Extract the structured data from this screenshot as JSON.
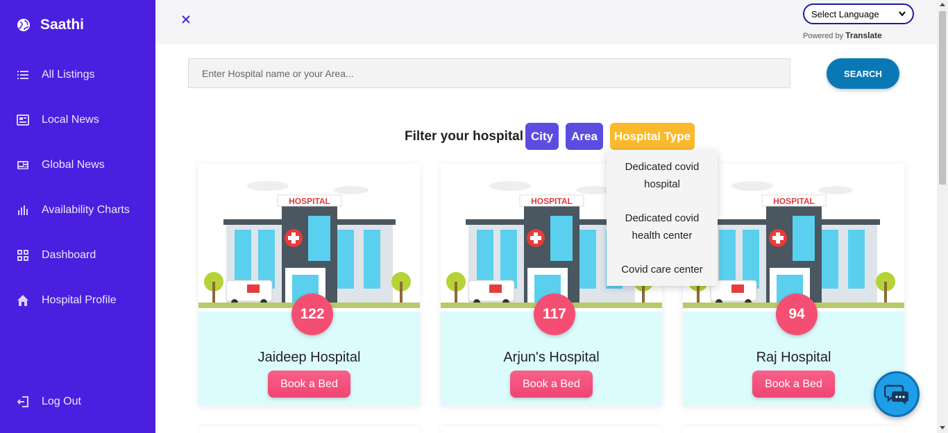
{
  "app": {
    "name": "Saathi"
  },
  "sidebar": {
    "items": [
      {
        "label": "All Listings",
        "icon": "list-icon"
      },
      {
        "label": "Local News",
        "icon": "newspaper-icon"
      },
      {
        "label": "Global News",
        "icon": "news-icon"
      },
      {
        "label": "Availability Charts",
        "icon": "bar-chart-icon"
      },
      {
        "label": "Dashboard",
        "icon": "grid-icon"
      },
      {
        "label": "Hospital Profile",
        "icon": "home-icon"
      }
    ],
    "logout": {
      "label": "Log Out",
      "icon": "logout-icon"
    }
  },
  "translate": {
    "select_label": "Select Language",
    "powered_prefix": "Powered by",
    "powered_brand": "Translate"
  },
  "search": {
    "placeholder": "Enter Hospital name or your Area...",
    "button": "SEARCH"
  },
  "filter": {
    "label": "Filter your hospital",
    "chips": {
      "city": "City",
      "area": "Area",
      "hospital_type": "Hospital Type"
    },
    "dropdown": {
      "option1_line1": "Dedicated covid",
      "option1_line2": "hospital",
      "option2_line1": "Dedicated covid",
      "option2_line2": "health center",
      "option3": "Covid care center"
    }
  },
  "hospitals": [
    {
      "name": "Jaideep Hospital",
      "beds": "122",
      "sign": "HOSPITAL",
      "action": "Book a Bed"
    },
    {
      "name": "Arjun's Hospital",
      "beds": "117",
      "sign": "HOSPITAL",
      "action": "Book a Bed"
    },
    {
      "name": "Raj Hospital",
      "beds": "94",
      "sign": "HOSPITAL",
      "action": "Book a Bed"
    }
  ],
  "colors": {
    "sidebar": "#4a1fe0",
    "accent_pink": "#f44f72",
    "search_button": "#0b78b6",
    "chip_purple": "#5b4de0",
    "chip_yellow": "#fbb92b"
  }
}
